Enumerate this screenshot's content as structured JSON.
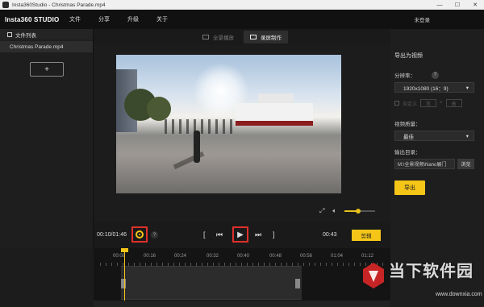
{
  "window": {
    "title": "Insta360Studio - Christmas Parade.mp4",
    "minimize": "—",
    "maximize": "☐",
    "close": "✕"
  },
  "menubar": {
    "brand": "Insta360 STUDIO",
    "items": [
      "文件",
      "分享",
      "升级",
      "关于"
    ],
    "login": "未登录"
  },
  "sidebar": {
    "header": "文件列表",
    "files": [
      "Christmas Parade.mp4"
    ],
    "add_label": "+"
  },
  "tabs": [
    {
      "label": "全景播放",
      "active": false
    },
    {
      "label": "录屏制作",
      "active": true
    }
  ],
  "transport": {
    "time_current": "00:10/01:46",
    "help": "?",
    "time_right": "00:43",
    "clip_label": "剪辑",
    "bracket_left": "[",
    "prev": "⏮",
    "play": "▶",
    "next": "⏭",
    "bracket_right": "]"
  },
  "timeline": {
    "ticks": [
      "00:08",
      "00:16",
      "00:24",
      "00:32",
      "00:40",
      "00:48",
      "00:56",
      "01:04",
      "01:12"
    ]
  },
  "export_panel": {
    "title": "导出为视频",
    "resolution_label": "分辨率：",
    "resolution_help": "?",
    "resolution_value": "1920x1080 (16：9)",
    "custom_label": "自定义",
    "custom_w": "宽",
    "custom_h": "高",
    "quality_label": "视频质量：",
    "quality_value": "最佳",
    "output_label": "输出目录：",
    "output_path": "M:\\全景视频\\Nano展门",
    "browse_label": "浏览",
    "export_label": "导出"
  },
  "volume": {
    "level": 0.45
  },
  "colors": {
    "accent": "#f5c518",
    "highlight": "#e0302a"
  },
  "watermark": {
    "text": "当下软件园",
    "url": "www.downxia.com"
  }
}
